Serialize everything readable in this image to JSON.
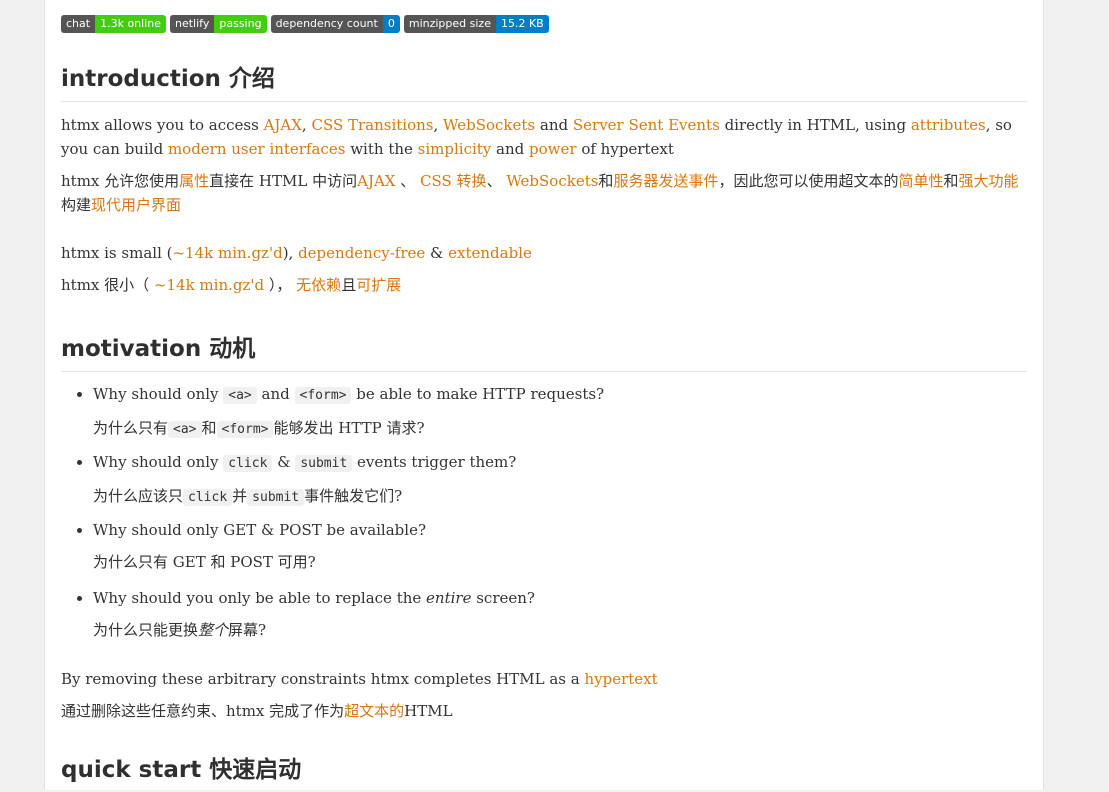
{
  "badges": [
    {
      "left": "chat",
      "right": "1.3k online",
      "color": "#4c1"
    },
    {
      "left": "netlify",
      "right": "passing",
      "color": "#4c1"
    },
    {
      "left": "dependency count",
      "right": "0",
      "color": "#007ec6"
    },
    {
      "left": "minzipped size",
      "right": "15.2 KB",
      "color": "#007ec6"
    }
  ],
  "intro": {
    "heading": "introduction 介绍",
    "p1": {
      "t1": "htmx allows you to access ",
      "l1": "AJAX",
      "t2": ", ",
      "l2": "CSS Transitions",
      "t3": ", ",
      "l3": "WebSockets",
      "t4": " and ",
      "l4": "Server Sent Events",
      "t5": " directly in HTML, using ",
      "l5": "attributes",
      "t6": ", so you can build ",
      "l6": "modern user interfaces",
      "t7": " with the ",
      "l7": "simplicity",
      "t8": " and ",
      "l8": "power",
      "t9": " of hypertext"
    },
    "p2": {
      "t1": "htmx 允许您使用",
      "l1": "属性",
      "t2": "直接在 HTML 中访问",
      "l2": "AJAX",
      "t3": " 、 ",
      "l3": "CSS 转换",
      "t4": "、 ",
      "l4": "WebSockets",
      "t5": "和",
      "l5": "服务器发送事件",
      "t6": "，因此您可以使用超文本的",
      "l6": "简单性",
      "t7": "和",
      "l7": "强大功能",
      "t8": "构建",
      "l8": "现代用户界面"
    },
    "p3": {
      "t1": "htmx is small (",
      "l1": "~14k min.gz'd",
      "t2": "), ",
      "l2": "dependency-free",
      "t3": " & ",
      "l3": "extendable"
    },
    "p4": {
      "t1": "htmx 很小（ ",
      "l1": "~14k min.gz'd",
      "t2": " ）， ",
      "l2": "无依赖",
      "t3": "且",
      "l3": "可扩展"
    }
  },
  "motivation": {
    "heading": "motivation 动机",
    "items": [
      {
        "en": {
          "t1": "Why should only ",
          "c1": "<a>",
          "t2": " and ",
          "c2": "<form>",
          "t3": " be able to make HTTP requests?"
        },
        "zh": {
          "t1": "为什么只有",
          "c1": "<a>",
          "t2": "和",
          "c2": "<form>",
          "t3": "能够发出 HTTP 请求?"
        }
      },
      {
        "en": {
          "t1": "Why should only ",
          "c1": "click",
          "t2": " & ",
          "c2": "submit",
          "t3": " events trigger them?"
        },
        "zh": {
          "t1": "为什么应该只",
          "c1": "click",
          "t2": "并",
          "c2": "submit",
          "t3": "事件触发它们?"
        }
      },
      {
        "en": {
          "t1": "Why should only GET & POST be available?"
        },
        "zh": {
          "t1": "为什么只有 GET 和 POST 可用?"
        }
      },
      {
        "en": {
          "t1": "Why should you only be able to replace the ",
          "em": "entire",
          "t2": " screen?"
        },
        "zh": {
          "t1": "为什么只能更换",
          "em": "整个",
          "t2": "屏幕?"
        }
      }
    ],
    "p5": {
      "t1": "By removing these arbitrary constraints htmx completes HTML as a ",
      "l1": "hypertext"
    },
    "p6": {
      "t1": "通过删除这些任意约束、htmx 完成了作为",
      "l1": "超文本的",
      "t2": "HTML"
    }
  },
  "next_heading": "quick start 快速启动"
}
